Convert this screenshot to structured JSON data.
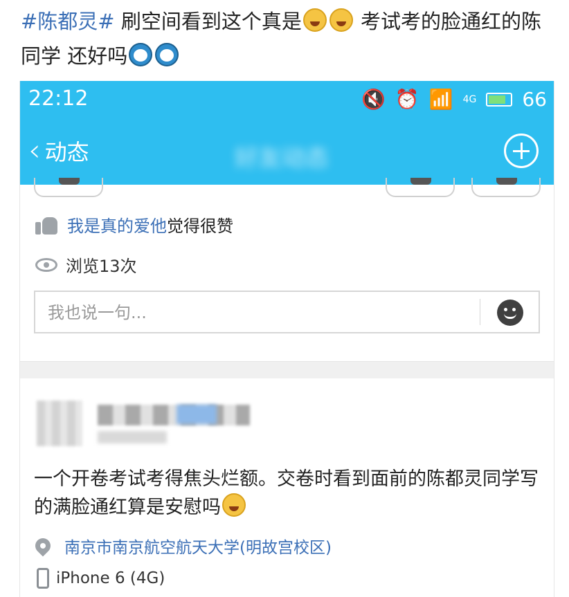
{
  "post": {
    "topic": "#陈都灵#",
    "text_1": " 刷空间看到这个真是",
    "text_2": " 考试考的脸通红的陈同学 还好吗",
    "emoji_1": "laughing-tears",
    "emoji_2": "doraemon"
  },
  "statusbar": {
    "time": "22:12",
    "network": "4G",
    "battery": "66"
  },
  "navbar": {
    "back_label": "动态",
    "title": "好友动态"
  },
  "likes": {
    "user": "我是真的爱他",
    "suffix": "觉得很赞"
  },
  "views": {
    "label": "浏览13次"
  },
  "comment": {
    "placeholder": "我也说一句..."
  },
  "feed_item": {
    "content": "一个开卷考试考得焦头烂额。交卷时看到面前的陈都灵同学写的满脸通红算是安慰吗",
    "location": "南京市南京航空航天大学(明故宫校区)",
    "device": "iPhone 6 (4G)"
  },
  "colors": {
    "header_blue": "#2ebef0",
    "link_blue": "#3b6fb6"
  }
}
